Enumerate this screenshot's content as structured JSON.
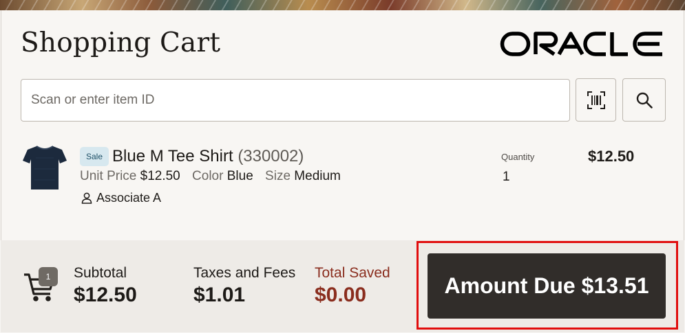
{
  "header": {
    "title": "Shopping Cart",
    "brand": "ORACLE"
  },
  "search": {
    "placeholder": "Scan or enter item ID",
    "value": "",
    "scan_icon": "barcode-icon",
    "search_icon": "search-icon"
  },
  "item": {
    "badge": "Sale",
    "name": "Blue M Tee Shirt",
    "item_id": "(330002)",
    "unit_price_label": "Unit Price",
    "unit_price": "$12.50",
    "color_label": "Color",
    "color": "Blue",
    "size_label": "Size",
    "size": "Medium",
    "associate": "Associate A",
    "quantity_label": "Quantity",
    "quantity": "1",
    "line_total": "$12.50"
  },
  "summary": {
    "cart_count": "1",
    "subtotal_label": "Subtotal",
    "subtotal": "$12.50",
    "taxes_label": "Taxes and Fees",
    "taxes": "$1.01",
    "saved_label": "Total Saved",
    "saved": "$0.00",
    "amount_due": "Amount Due $13.51"
  },
  "colors": {
    "primary_button": "#312d2a",
    "saved_text": "#8a2d1e",
    "highlight": "#e10d0d",
    "sale_badge_bg": "#d7e8ef"
  }
}
